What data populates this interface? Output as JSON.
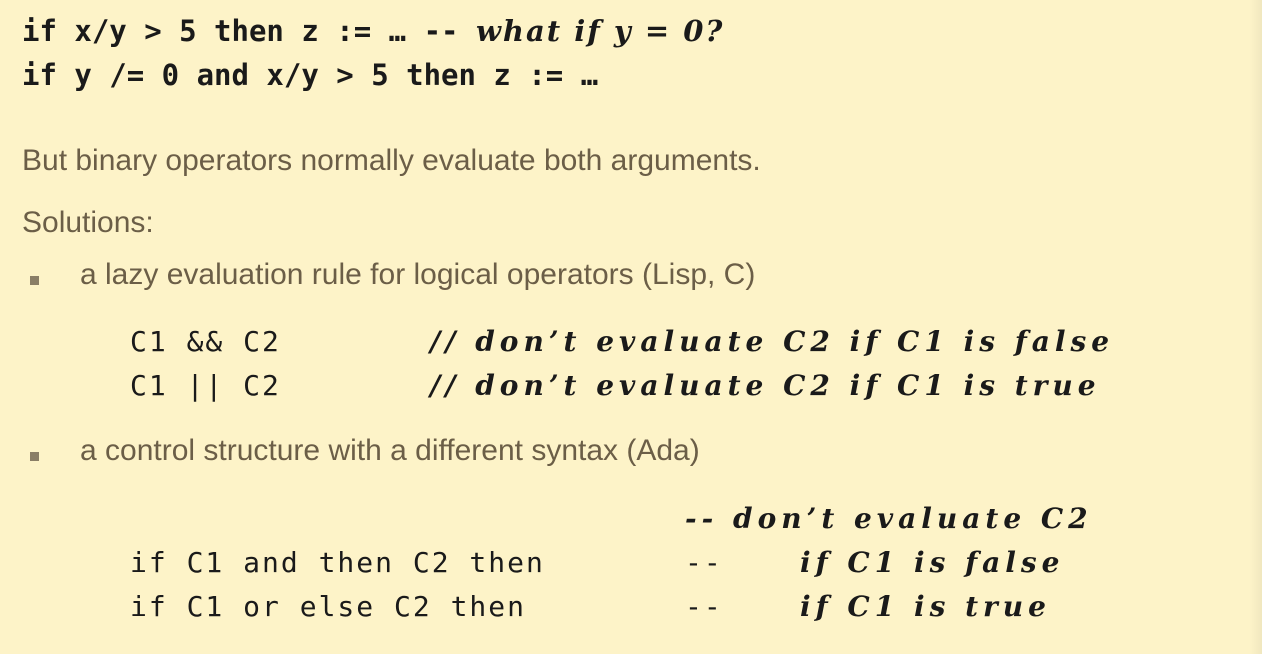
{
  "code_top": {
    "line1_code": "if x/y > 5 then z := … -- ",
    "line1_comment": "what if y = 0?",
    "line2_code": "if y /= 0 and x/y > 5 then z := …"
  },
  "prose": {
    "note": "But binary operators normally evaluate both arguments.",
    "solutions": "Solutions:"
  },
  "bullets": [
    "a lazy evaluation rule for logical operators (Lisp, C)",
    "a control structure with a different syntax (Ada)"
  ],
  "lazy_code": [
    {
      "code": "C1 && C2",
      "comment": "// don’t evaluate C2 if C1 is false"
    },
    {
      "code": "C1 || C2",
      "comment": "// don’t evaluate C2 if C1 is true"
    }
  ],
  "ada_code": {
    "comment_head": "-- don’t evaluate C2",
    "lines": [
      {
        "code": "if C1 and then C2 then",
        "dash": "--",
        "comment": "if C1 is false"
      },
      {
        "code": "if C1 or else C2 then",
        "dash": "--",
        "comment": "if C1 is true"
      }
    ]
  },
  "colors": {
    "background": "#fdf3c8",
    "prose_text": "#6b5e47",
    "code_text": "#1a1a1a"
  }
}
